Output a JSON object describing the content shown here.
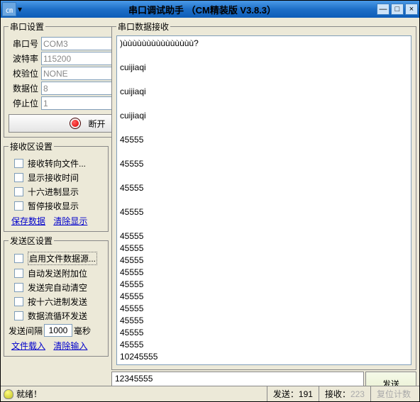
{
  "title": "串口调试助手 （CM精装版 V3.8.3）",
  "serial": {
    "legend": "串口设置",
    "port_lbl": "串口号",
    "port_val": "COM3",
    "baud_lbl": "波特率",
    "baud_val": "115200",
    "parity_lbl": "校验位",
    "parity_val": "NONE",
    "data_lbl": "数据位",
    "data_val": "8",
    "stop_lbl": "停止位",
    "stop_val": "1",
    "disconnect": "断开"
  },
  "recv": {
    "legend": "接收区设置",
    "opt1": "接收转向文件...",
    "opt2": "显示接收时间",
    "opt3": "十六进制显示",
    "opt4": "暂停接收显示",
    "save": "保存数据",
    "clear": "清除显示"
  },
  "send": {
    "legend": "发送区设置",
    "opt1": "启用文件数据源...",
    "opt2": "自动发送附加位",
    "opt3": "发送完自动清空",
    "opt4": "按十六进制发送",
    "opt5": "数据流循环发送",
    "interval_lbl": "发送间隔",
    "interval_val": "1000",
    "interval_unit": "毫秒",
    "load": "文件载入",
    "clear": "清除输入"
  },
  "data_area": {
    "legend": "串口数据接收",
    "lines": [
      ")ùùùùùùùùùùùùùùù?",
      "",
      "cuijiaqi",
      "",
      "cuijiaqi",
      "",
      "cuijiaqi",
      "",
      "45555",
      "",
      "45555",
      "",
      "45555",
      "",
      "45555",
      "",
      "45555",
      "45555",
      "45555",
      "45555",
      "45555",
      "45555",
      "45555",
      "45555",
      "45555",
      "45555",
      "10245555"
    ],
    "input": "12345555",
    "send_btn": "发送"
  },
  "status": {
    "ready": "就绪！",
    "tx_lbl": "发送：",
    "tx_val": "191",
    "rx_lbl": "接收：",
    "rx_val": "223",
    "reset": "复位计数"
  }
}
